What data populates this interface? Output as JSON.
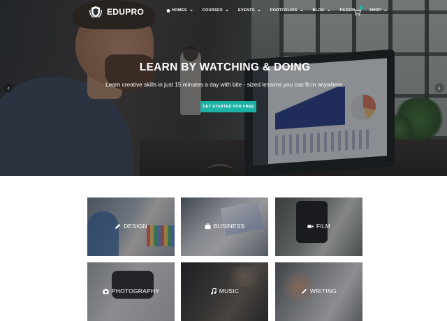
{
  "brand": {
    "name": "EDUPRO",
    "accent": "#1eb2a6"
  },
  "nav": {
    "items": [
      {
        "label": "HOMES",
        "icon": "home-icon",
        "dropdown": true
      },
      {
        "label": "COURSES",
        "dropdown": true
      },
      {
        "label": "EVENTS",
        "dropdown": true
      },
      {
        "label": "PORTFOLIOS",
        "dropdown": true
      },
      {
        "label": "BLOG",
        "dropdown": true
      },
      {
        "label": "PAGES",
        "dropdown": true
      },
      {
        "label": "SHOP",
        "dropdown": true
      }
    ],
    "cart_icon": "cart-icon"
  },
  "hero": {
    "title": "LEARN BY WATCHING & DOING",
    "subtitle": "Learn creative skills in just 15 minutes a day with bite - sized lessons you can fit in anywhere.",
    "cta_label": "GET STARTED FOR FREE",
    "prev_icon": "chevron-left-icon",
    "next_icon": "chevron-right-icon",
    "prev_glyph": "‹",
    "next_glyph": "›"
  },
  "categories": [
    {
      "label": "DESIGN",
      "icon": "pencil-icon"
    },
    {
      "label": "BUSINESS",
      "icon": "briefcase-icon"
    },
    {
      "label": "FILM",
      "icon": "video-camera-icon"
    },
    {
      "label": "PHOTOGRAPHY",
      "icon": "camera-icon"
    },
    {
      "label": "MUSIC",
      "icon": "music-note-icon"
    },
    {
      "label": "WRITING",
      "icon": "pen-icon"
    }
  ]
}
